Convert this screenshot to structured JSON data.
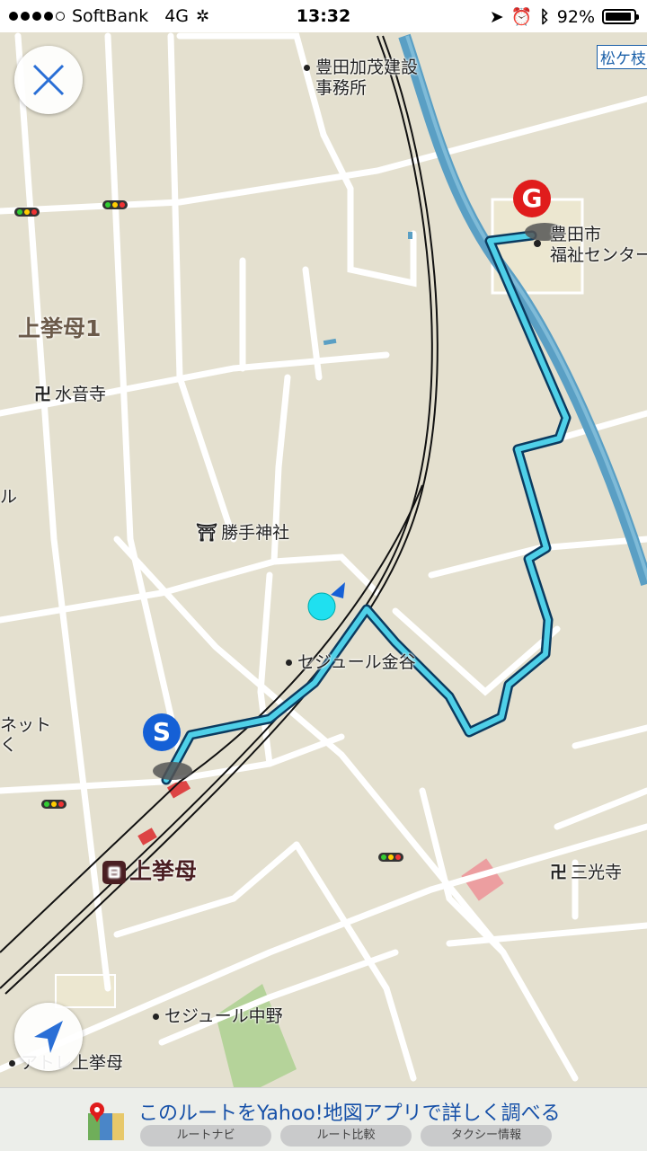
{
  "status_bar": {
    "carrier": "SoftBank",
    "network": "4G",
    "time": "13:32",
    "battery": "92%",
    "battery_level": 0.92,
    "signal_bars": 4
  },
  "map": {
    "labels": {
      "office": "豊田加茂建設\n事務所",
      "welfare_center": "豊田市\n福祉センター",
      "district": "上挙母1",
      "suion_temple": "水音寺",
      "katte_shrine": "勝手神社",
      "sejour_kanaya": "セジュール金谷",
      "station": "上挙母",
      "sankoji": "三光寺",
      "sejour_nakano": "セジュール中野",
      "atreil": "アトレ上挙母",
      "netto": "ネット\nく",
      "ru": "ル",
      "matsugae": "松ケ枝"
    },
    "start_marker": "S",
    "goal_marker": "G",
    "temple_symbol": "卍",
    "shrine_symbol": "⛩",
    "station_symbol": "🚉"
  },
  "buttons": {
    "close_icon": "close-icon",
    "locate_icon": "location-arrow-icon"
  },
  "banner": {
    "title": "このルートをYahoo!地図アプリで詳しく調べる",
    "pills": [
      "ルートナビ",
      "ルート比較",
      "タクシー情報"
    ]
  },
  "colors": {
    "route": "#1b6fa8",
    "route_inner": "#4fd0e8",
    "river": "#5a9fc4",
    "start": "#1560d6",
    "goal": "#e01c1c",
    "current_location": "#1fe0f0"
  }
}
